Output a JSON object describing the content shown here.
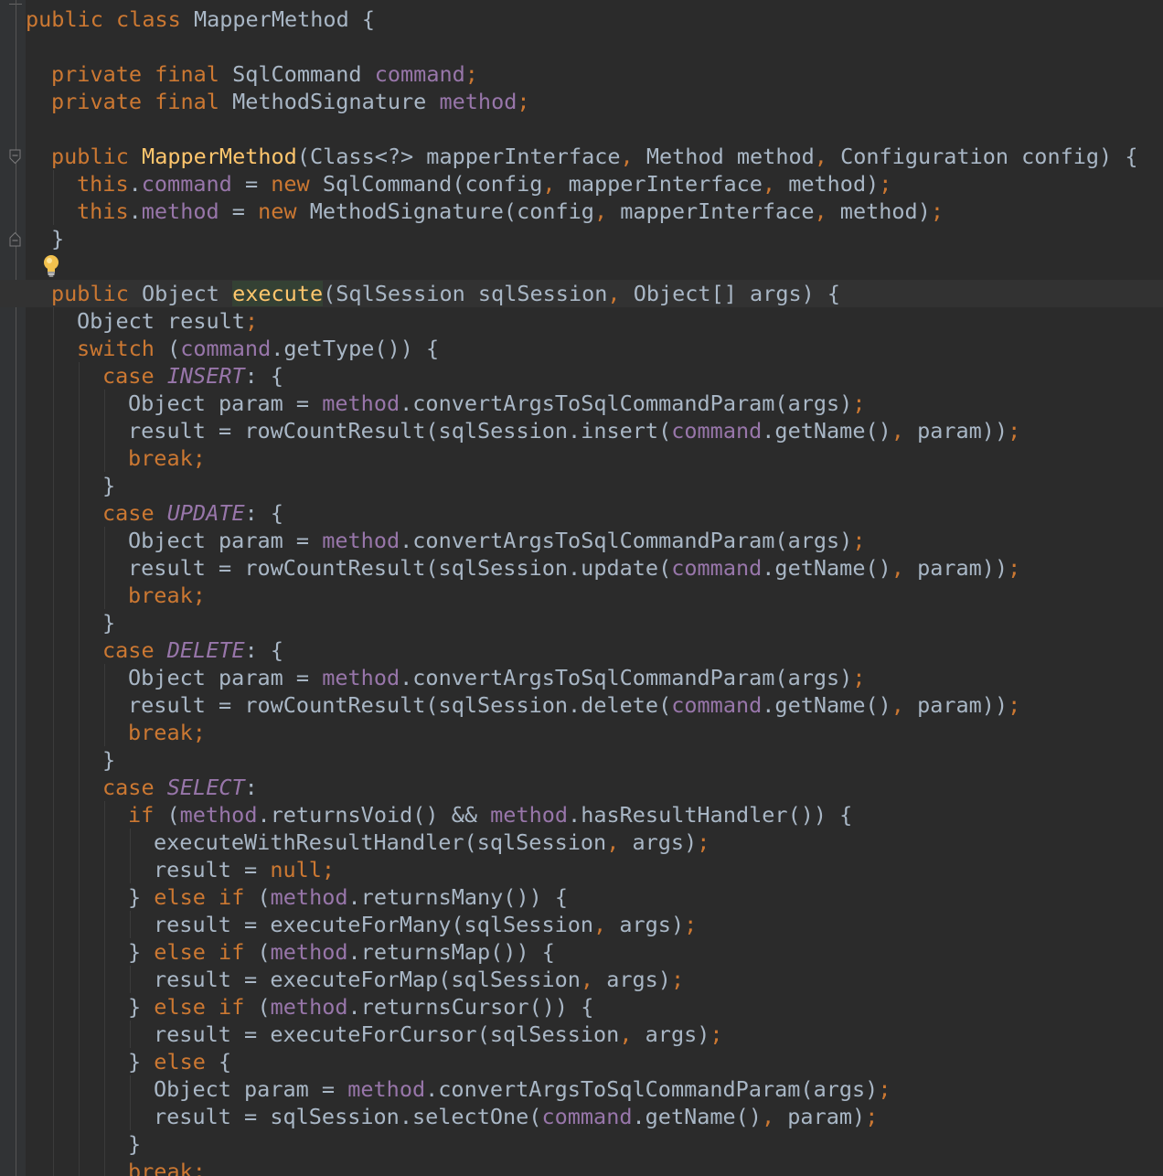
{
  "editor": {
    "language": "Java",
    "theme": "Darcula",
    "colors": {
      "background": "#2b2b2b",
      "gutter": "#313335",
      "keyword": "#cc7832",
      "field": "#9876aa",
      "function_declaration": "#ffc66d",
      "plain_text": "#a9b7c6",
      "current_line": "#323232"
    },
    "current_line_index": 10,
    "gutter_markers": [
      {
        "icon": "fold-open-icon",
        "line_index": 5
      },
      {
        "icon": "fold-close-icon",
        "line_index": 8
      },
      {
        "icon": "intention-bulb-icon",
        "line_index": 9
      },
      {
        "icon": "fold-open-icon",
        "line_index": 10
      }
    ],
    "lines": [
      {
        "indent": 0,
        "tokens": [
          {
            "t": "public",
            "c": "kw"
          },
          {
            "t": " "
          },
          {
            "t": "class",
            "c": "kw"
          },
          {
            "t": " MapperMethod {"
          }
        ]
      },
      {
        "indent": 0,
        "tokens": []
      },
      {
        "indent": 1,
        "tokens": [
          {
            "t": "private",
            "c": "kw"
          },
          {
            "t": " "
          },
          {
            "t": "final",
            "c": "kw"
          },
          {
            "t": " SqlCommand "
          },
          {
            "t": "command",
            "c": "fld"
          },
          {
            "t": ";",
            "c": "kw"
          }
        ]
      },
      {
        "indent": 1,
        "tokens": [
          {
            "t": "private",
            "c": "kw"
          },
          {
            "t": " "
          },
          {
            "t": "final",
            "c": "kw"
          },
          {
            "t": " MethodSignature "
          },
          {
            "t": "method",
            "c": "fld"
          },
          {
            "t": ";",
            "c": "kw"
          }
        ]
      },
      {
        "indent": 0,
        "tokens": []
      },
      {
        "indent": 1,
        "tokens": [
          {
            "t": "public",
            "c": "kw"
          },
          {
            "t": " "
          },
          {
            "t": "MapperMethod",
            "c": "fn"
          },
          {
            "t": "(Class<?> mapperInterface"
          },
          {
            "t": ",",
            "c": "kw"
          },
          {
            "t": " Method method"
          },
          {
            "t": ",",
            "c": "kw"
          },
          {
            "t": " Configuration config) {"
          }
        ]
      },
      {
        "indent": 2,
        "tokens": [
          {
            "t": "this",
            "c": "kw"
          },
          {
            "t": "."
          },
          {
            "t": "command",
            "c": "fld"
          },
          {
            "t": " = "
          },
          {
            "t": "new",
            "c": "kw"
          },
          {
            "t": " SqlCommand(config"
          },
          {
            "t": ",",
            "c": "kw"
          },
          {
            "t": " mapperInterface"
          },
          {
            "t": ",",
            "c": "kw"
          },
          {
            "t": " method)"
          },
          {
            "t": ";",
            "c": "kw"
          }
        ]
      },
      {
        "indent": 2,
        "tokens": [
          {
            "t": "this",
            "c": "kw"
          },
          {
            "t": "."
          },
          {
            "t": "method",
            "c": "fld"
          },
          {
            "t": " = "
          },
          {
            "t": "new",
            "c": "kw"
          },
          {
            "t": " MethodSignature(config"
          },
          {
            "t": ",",
            "c": "kw"
          },
          {
            "t": " mapperInterface"
          },
          {
            "t": ",",
            "c": "kw"
          },
          {
            "t": " method)"
          },
          {
            "t": ";",
            "c": "kw"
          }
        ]
      },
      {
        "indent": 1,
        "tokens": [
          {
            "t": "}"
          }
        ]
      },
      {
        "indent": 0,
        "tokens": []
      },
      {
        "indent": 1,
        "tokens": [
          {
            "t": "public",
            "c": "kw"
          },
          {
            "t": " Object "
          },
          {
            "t": "execute",
            "c": "fn hl"
          },
          {
            "t": "(SqlSession sqlSession"
          },
          {
            "t": ",",
            "c": "kw"
          },
          {
            "t": " Object[] args) {"
          }
        ]
      },
      {
        "indent": 2,
        "tokens": [
          {
            "t": "Object result"
          },
          {
            "t": ";",
            "c": "kw"
          }
        ]
      },
      {
        "indent": 2,
        "tokens": [
          {
            "t": "switch",
            "c": "kw"
          },
          {
            "t": " ("
          },
          {
            "t": "command",
            "c": "fld"
          },
          {
            "t": ".getType()) {"
          }
        ]
      },
      {
        "indent": 3,
        "tokens": [
          {
            "t": "case",
            "c": "kw"
          },
          {
            "t": " "
          },
          {
            "t": "INSERT",
            "c": "efld"
          },
          {
            "t": ": {"
          }
        ]
      },
      {
        "indent": 4,
        "tokens": [
          {
            "t": "Object param = "
          },
          {
            "t": "method",
            "c": "fld"
          },
          {
            "t": ".convertArgsToSqlCommandParam(args)"
          },
          {
            "t": ";",
            "c": "kw"
          }
        ]
      },
      {
        "indent": 4,
        "tokens": [
          {
            "t": "result = rowCountResult(sqlSession.insert("
          },
          {
            "t": "command",
            "c": "fld"
          },
          {
            "t": ".getName()"
          },
          {
            "t": ",",
            "c": "kw"
          },
          {
            "t": " param))"
          },
          {
            "t": ";",
            "c": "kw"
          }
        ]
      },
      {
        "indent": 4,
        "tokens": [
          {
            "t": "break;",
            "c": "kw"
          }
        ]
      },
      {
        "indent": 3,
        "tokens": [
          {
            "t": "}"
          }
        ]
      },
      {
        "indent": 3,
        "tokens": [
          {
            "t": "case",
            "c": "kw"
          },
          {
            "t": " "
          },
          {
            "t": "UPDATE",
            "c": "efld"
          },
          {
            "t": ": {"
          }
        ]
      },
      {
        "indent": 4,
        "tokens": [
          {
            "t": "Object param = "
          },
          {
            "t": "method",
            "c": "fld"
          },
          {
            "t": ".convertArgsToSqlCommandParam(args)"
          },
          {
            "t": ";",
            "c": "kw"
          }
        ]
      },
      {
        "indent": 4,
        "tokens": [
          {
            "t": "result = rowCountResult(sqlSession.update("
          },
          {
            "t": "command",
            "c": "fld"
          },
          {
            "t": ".getName()"
          },
          {
            "t": ",",
            "c": "kw"
          },
          {
            "t": " param))"
          },
          {
            "t": ";",
            "c": "kw"
          }
        ]
      },
      {
        "indent": 4,
        "tokens": [
          {
            "t": "break;",
            "c": "kw"
          }
        ]
      },
      {
        "indent": 3,
        "tokens": [
          {
            "t": "}"
          }
        ]
      },
      {
        "indent": 3,
        "tokens": [
          {
            "t": "case",
            "c": "kw"
          },
          {
            "t": " "
          },
          {
            "t": "DELETE",
            "c": "efld"
          },
          {
            "t": ": {"
          }
        ]
      },
      {
        "indent": 4,
        "tokens": [
          {
            "t": "Object param = "
          },
          {
            "t": "method",
            "c": "fld"
          },
          {
            "t": ".convertArgsToSqlCommandParam(args)"
          },
          {
            "t": ";",
            "c": "kw"
          }
        ]
      },
      {
        "indent": 4,
        "tokens": [
          {
            "t": "result = rowCountResult(sqlSession.delete("
          },
          {
            "t": "command",
            "c": "fld"
          },
          {
            "t": ".getName()"
          },
          {
            "t": ",",
            "c": "kw"
          },
          {
            "t": " param))"
          },
          {
            "t": ";",
            "c": "kw"
          }
        ]
      },
      {
        "indent": 4,
        "tokens": [
          {
            "t": "break;",
            "c": "kw"
          }
        ]
      },
      {
        "indent": 3,
        "tokens": [
          {
            "t": "}"
          }
        ]
      },
      {
        "indent": 3,
        "tokens": [
          {
            "t": "case",
            "c": "kw"
          },
          {
            "t": " "
          },
          {
            "t": "SELECT",
            "c": "efld"
          },
          {
            "t": ":"
          }
        ]
      },
      {
        "indent": 4,
        "tokens": [
          {
            "t": "if",
            "c": "kw"
          },
          {
            "t": " ("
          },
          {
            "t": "method",
            "c": "fld"
          },
          {
            "t": ".returnsVoid() && "
          },
          {
            "t": "method",
            "c": "fld"
          },
          {
            "t": ".hasResultHandler()) {"
          }
        ]
      },
      {
        "indent": 5,
        "tokens": [
          {
            "t": "executeWithResultHandler(sqlSession"
          },
          {
            "t": ",",
            "c": "kw"
          },
          {
            "t": " args)"
          },
          {
            "t": ";",
            "c": "kw"
          }
        ]
      },
      {
        "indent": 5,
        "tokens": [
          {
            "t": "result = "
          },
          {
            "t": "null;",
            "c": "kw"
          }
        ]
      },
      {
        "indent": 4,
        "tokens": [
          {
            "t": "} "
          },
          {
            "t": "else",
            "c": "kw"
          },
          {
            "t": " "
          },
          {
            "t": "if",
            "c": "kw"
          },
          {
            "t": " ("
          },
          {
            "t": "method",
            "c": "fld"
          },
          {
            "t": ".returnsMany()) {"
          }
        ]
      },
      {
        "indent": 5,
        "tokens": [
          {
            "t": "result = executeForMany(sqlSession"
          },
          {
            "t": ",",
            "c": "kw"
          },
          {
            "t": " args)"
          },
          {
            "t": ";",
            "c": "kw"
          }
        ]
      },
      {
        "indent": 4,
        "tokens": [
          {
            "t": "} "
          },
          {
            "t": "else",
            "c": "kw"
          },
          {
            "t": " "
          },
          {
            "t": "if",
            "c": "kw"
          },
          {
            "t": " ("
          },
          {
            "t": "method",
            "c": "fld"
          },
          {
            "t": ".returnsMap()) {"
          }
        ]
      },
      {
        "indent": 5,
        "tokens": [
          {
            "t": "result = executeForMap(sqlSession"
          },
          {
            "t": ",",
            "c": "kw"
          },
          {
            "t": " args)"
          },
          {
            "t": ";",
            "c": "kw"
          }
        ]
      },
      {
        "indent": 4,
        "tokens": [
          {
            "t": "} "
          },
          {
            "t": "else",
            "c": "kw"
          },
          {
            "t": " "
          },
          {
            "t": "if",
            "c": "kw"
          },
          {
            "t": " ("
          },
          {
            "t": "method",
            "c": "fld"
          },
          {
            "t": ".returnsCursor()) {"
          }
        ]
      },
      {
        "indent": 5,
        "tokens": [
          {
            "t": "result = executeForCursor(sqlSession"
          },
          {
            "t": ",",
            "c": "kw"
          },
          {
            "t": " args)"
          },
          {
            "t": ";",
            "c": "kw"
          }
        ]
      },
      {
        "indent": 4,
        "tokens": [
          {
            "t": "} "
          },
          {
            "t": "else",
            "c": "kw"
          },
          {
            "t": " {"
          }
        ]
      },
      {
        "indent": 5,
        "tokens": [
          {
            "t": "Object param = "
          },
          {
            "t": "method",
            "c": "fld"
          },
          {
            "t": ".convertArgsToSqlCommandParam(args)"
          },
          {
            "t": ";",
            "c": "kw"
          }
        ]
      },
      {
        "indent": 5,
        "tokens": [
          {
            "t": "result = sqlSession.selectOne("
          },
          {
            "t": "command",
            "c": "fld"
          },
          {
            "t": ".getName()"
          },
          {
            "t": ",",
            "c": "kw"
          },
          {
            "t": " param)"
          },
          {
            "t": ";",
            "c": "kw"
          }
        ]
      },
      {
        "indent": 4,
        "tokens": [
          {
            "t": "}"
          }
        ]
      },
      {
        "indent": 4,
        "tokens": [
          {
            "t": "break;",
            "c": "kw"
          }
        ]
      }
    ]
  }
}
